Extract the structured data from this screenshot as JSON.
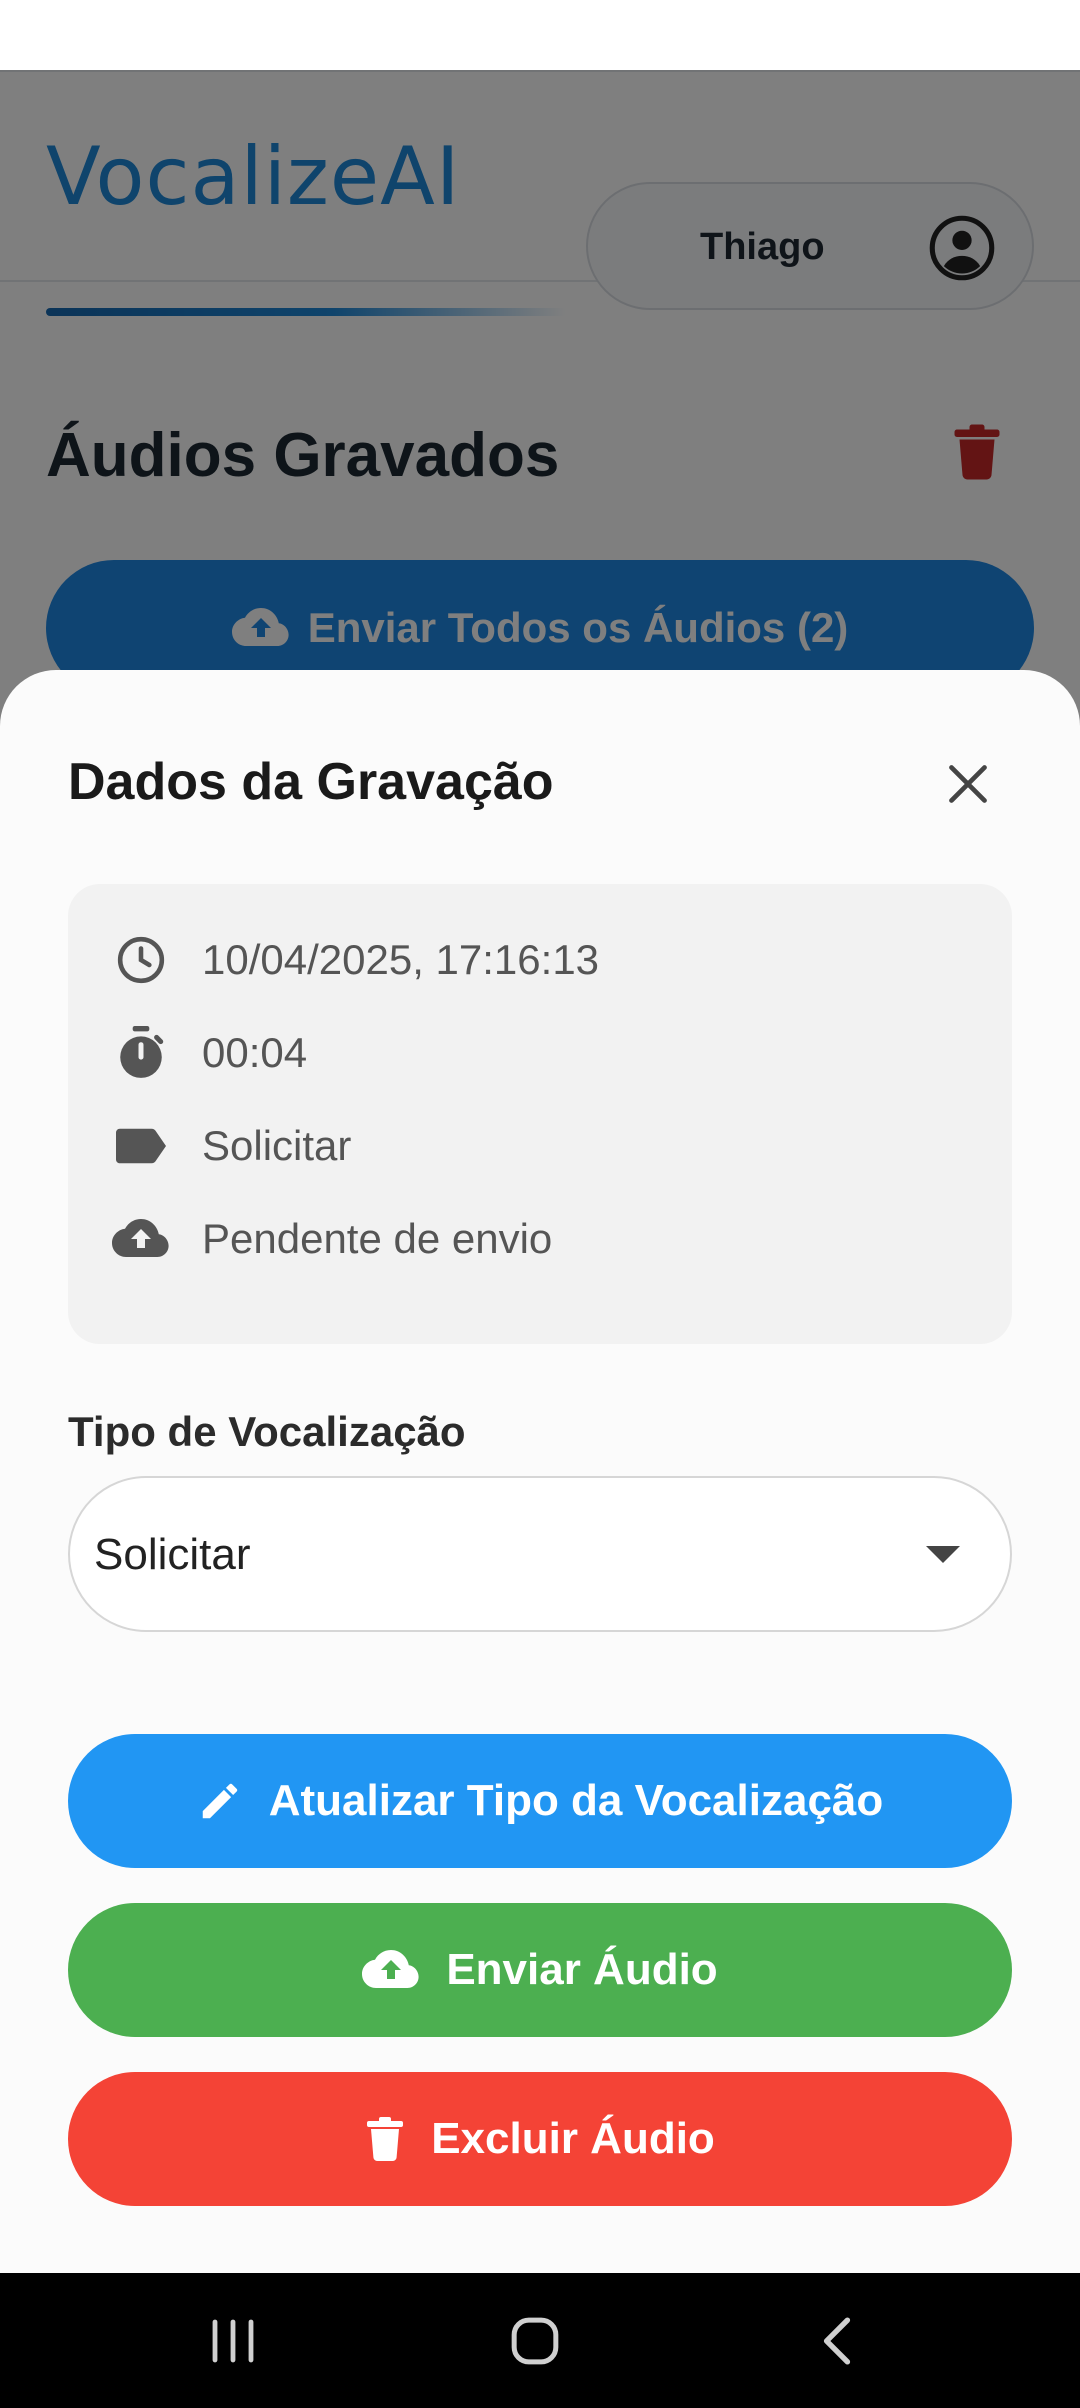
{
  "app": {
    "logo_text": "VocalizeAI",
    "user_name": "Thiago",
    "page_title": "Áudios Gravados",
    "send_all_label": "Enviar Todos os Áudios (2)"
  },
  "sheet": {
    "title": "Dados da Gravação",
    "info": {
      "datetime": "10/04/2025, 17:16:13",
      "duration": "00:04",
      "type": "Solicitar",
      "status": "Pendente de envio"
    },
    "field_label": "Tipo de Vocalização",
    "selected_type": "Solicitar",
    "buttons": {
      "update": "Atualizar Tipo da Vocalização",
      "send": "Enviar Áudio",
      "delete": "Excluir Áudio"
    }
  },
  "colors": {
    "brand_blue": "#1e88d8",
    "update_button": "#2196f3",
    "send_button": "#4caf50",
    "delete_button": "#f44336",
    "trash_icon": "#c62828"
  },
  "icons": [
    "user-avatar-icon",
    "trash-icon",
    "cloud-upload-icon",
    "close-icon",
    "clock-icon",
    "stopwatch-icon",
    "label-icon",
    "pencil-icon",
    "nav-recents-icon",
    "nav-home-icon",
    "nav-back-icon"
  ]
}
